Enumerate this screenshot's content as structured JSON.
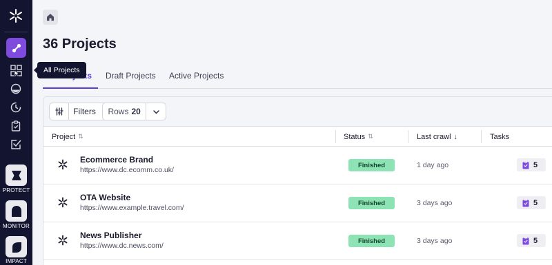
{
  "sidebar": {
    "sections": [
      {
        "label": "PROTECT"
      },
      {
        "label": "MONITOR"
      },
      {
        "label": "IMPACT"
      }
    ]
  },
  "tooltip": {
    "text": "All Projects"
  },
  "page": {
    "title": "36 Projects"
  },
  "tabs": [
    {
      "label": "All Projects",
      "active": true
    },
    {
      "label": "Draft Projects",
      "active": false
    },
    {
      "label": "Active Projects",
      "active": false
    }
  ],
  "toolbar": {
    "filters_label": "Filters",
    "rows_label": "Rows",
    "rows_value": "20"
  },
  "table": {
    "columns": {
      "project": "Project",
      "status": "Status",
      "last_crawl": "Last crawl",
      "tasks": "Tasks"
    },
    "rows": [
      {
        "name": "Ecommerce Brand",
        "url": "https://www.dc.ecomm.co.uk/",
        "status": "Finished",
        "last_crawl": "1 day ago",
        "tasks": "5"
      },
      {
        "name": "OTA Website",
        "url": "https://www.example.travel.com/",
        "status": "Finished",
        "last_crawl": "3 days ago",
        "tasks": "5"
      },
      {
        "name": "News Publisher",
        "url": "https://www.dc.news.com/",
        "status": "Finished",
        "last_crawl": "3 days ago",
        "tasks": "5"
      }
    ]
  },
  "colors": {
    "sidebar_bg": "#131530",
    "accent": "#7f4bde",
    "tab_underline": "#5b3ad6",
    "status_finished": "#8de3b4",
    "task_icon": "#7f4bde"
  }
}
